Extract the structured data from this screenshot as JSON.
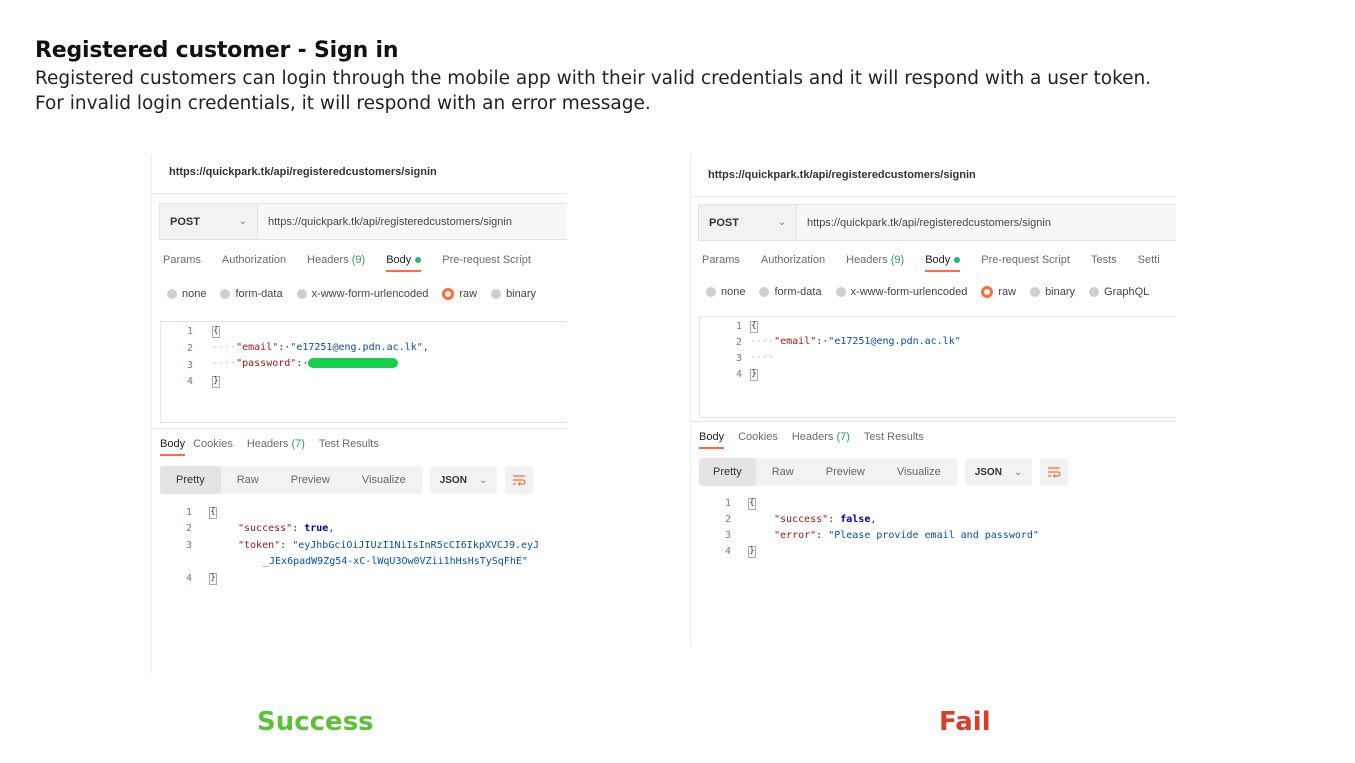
{
  "heading": "Registered customer - Sign in",
  "description": [
    "Registered customers can login through the mobile app with their valid credentials and it will respond with a user token.",
    "For invalid login credentials, it will respond with an error message."
  ],
  "colors": {
    "accent": "#ff6c37",
    "success": "#5cc135",
    "fail": "#d6402a"
  },
  "left": {
    "url_title": "https://quickpark.tk/api/registeredcustomers/signin",
    "method": "POST",
    "url": "https://quickpark.tk/api/registeredcustomers/signin",
    "req_tabs": {
      "params": "Params",
      "authorization": "Authorization",
      "headers": "Headers",
      "headers_count": "(9)",
      "body": "Body",
      "prerequest": "Pre-request Script"
    },
    "body_types": {
      "none": "none",
      "form_data": "form-data",
      "urlencoded": "x-www-form-urlencoded",
      "raw": "raw",
      "binary": "binary"
    },
    "request_lines": {
      "l1": "1",
      "l2": "2",
      "l3": "3",
      "l4": "4",
      "email_key": "\"email\"",
      "email_val": "\"e17251@eng.pdn.ac.lk\"",
      "password_key": "\"password\""
    },
    "resp_tabs": {
      "body": "Body",
      "cookies": "Cookies",
      "headers": "Headers",
      "headers_count": "(7)",
      "tests": "Test Results"
    },
    "view_modes": {
      "pretty": "Pretty",
      "raw": "Raw",
      "preview": "Preview",
      "visualize": "Visualize"
    },
    "format": "JSON",
    "response_lines": {
      "l1": "1",
      "l2": "2",
      "l3": "3",
      "l4": "4",
      "success_key": "\"success\"",
      "success_val": "true",
      "token_key": "\"token\"",
      "token_val_1": "\"eyJhbGciOiJIUzI1NiIsInR5cCI6IkpXVCJ9.eyJ",
      "token_val_2": "_JEx6padW9Zg54-xC-lWqU3Ow0VZii1hHsHsTySqFhE\""
    }
  },
  "right": {
    "url_title": "https://quickpark.tk/api/registeredcustomers/signin",
    "method": "POST",
    "url": "https://quickpark.tk/api/registeredcustomers/signin",
    "req_tabs": {
      "params": "Params",
      "authorization": "Authorization",
      "headers": "Headers",
      "headers_count": "(9)",
      "body": "Body",
      "prerequest": "Pre-request Script",
      "tests": "Tests",
      "settings": "Setti"
    },
    "body_types": {
      "none": "none",
      "form_data": "form-data",
      "urlencoded": "x-www-form-urlencoded",
      "raw": "raw",
      "binary": "binary",
      "graphql": "GraphQL"
    },
    "request_lines": {
      "l1": "1",
      "l2": "2",
      "l3": "3",
      "l4": "4",
      "email_key": "\"email\"",
      "email_val": "\"e17251@eng.pdn.ac.lk\""
    },
    "resp_tabs": {
      "body": "Body",
      "cookies": "Cookies",
      "headers": "Headers",
      "headers_count": "(7)",
      "tests": "Test Results"
    },
    "view_modes": {
      "pretty": "Pretty",
      "raw": "Raw",
      "preview": "Preview",
      "visualize": "Visualize"
    },
    "format": "JSON",
    "response_lines": {
      "l1": "1",
      "l2": "2",
      "l3": "3",
      "l4": "4",
      "success_key": "\"success\"",
      "success_val": "false",
      "error_key": "\"error\"",
      "error_val": "\"Please provide email and password\""
    }
  },
  "labels": {
    "success": "Success",
    "fail": "Fail"
  }
}
